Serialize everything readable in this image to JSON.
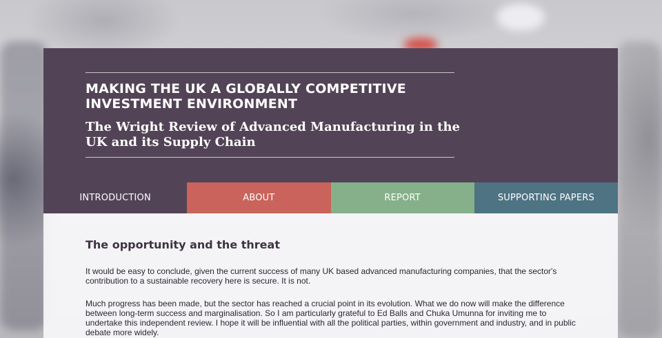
{
  "header": {
    "title": "MAKING THE UK A GLOBALLY COMPETITIVE INVESTMENT ENVIRONMENT",
    "subtitle": "The Wright Review of Advanced Manufacturing in the UK and its Supply Chain"
  },
  "nav": {
    "tabs": [
      {
        "label": "INTRODUCTION",
        "color": "#524456"
      },
      {
        "label": "ABOUT",
        "color": "#c9635b"
      },
      {
        "label": "REPORT",
        "color": "#86b089"
      },
      {
        "label": "SUPPORTING PAPERS",
        "color": "#4e7383"
      }
    ]
  },
  "main": {
    "heading": "The opportunity and the threat",
    "paragraphs": [
      "It would be easy to conclude, given the current success of many UK based advanced manufacturing companies, that the sector's contribution to a sustainable recovery here is secure. It is not.",
      "Much progress has been made, but the sector has reached a crucial point in its evolution. What we do now will make the difference between long-term success and marginalisation. So I am particularly grateful to Ed Balls and Chuka Umunna for inviting me to undertake this independent review. I hope it will be influential with all the political parties, within government and industry, and in public debate more widely."
    ]
  },
  "colors": {
    "header_bg": "#524456",
    "text": "#2d2530"
  }
}
